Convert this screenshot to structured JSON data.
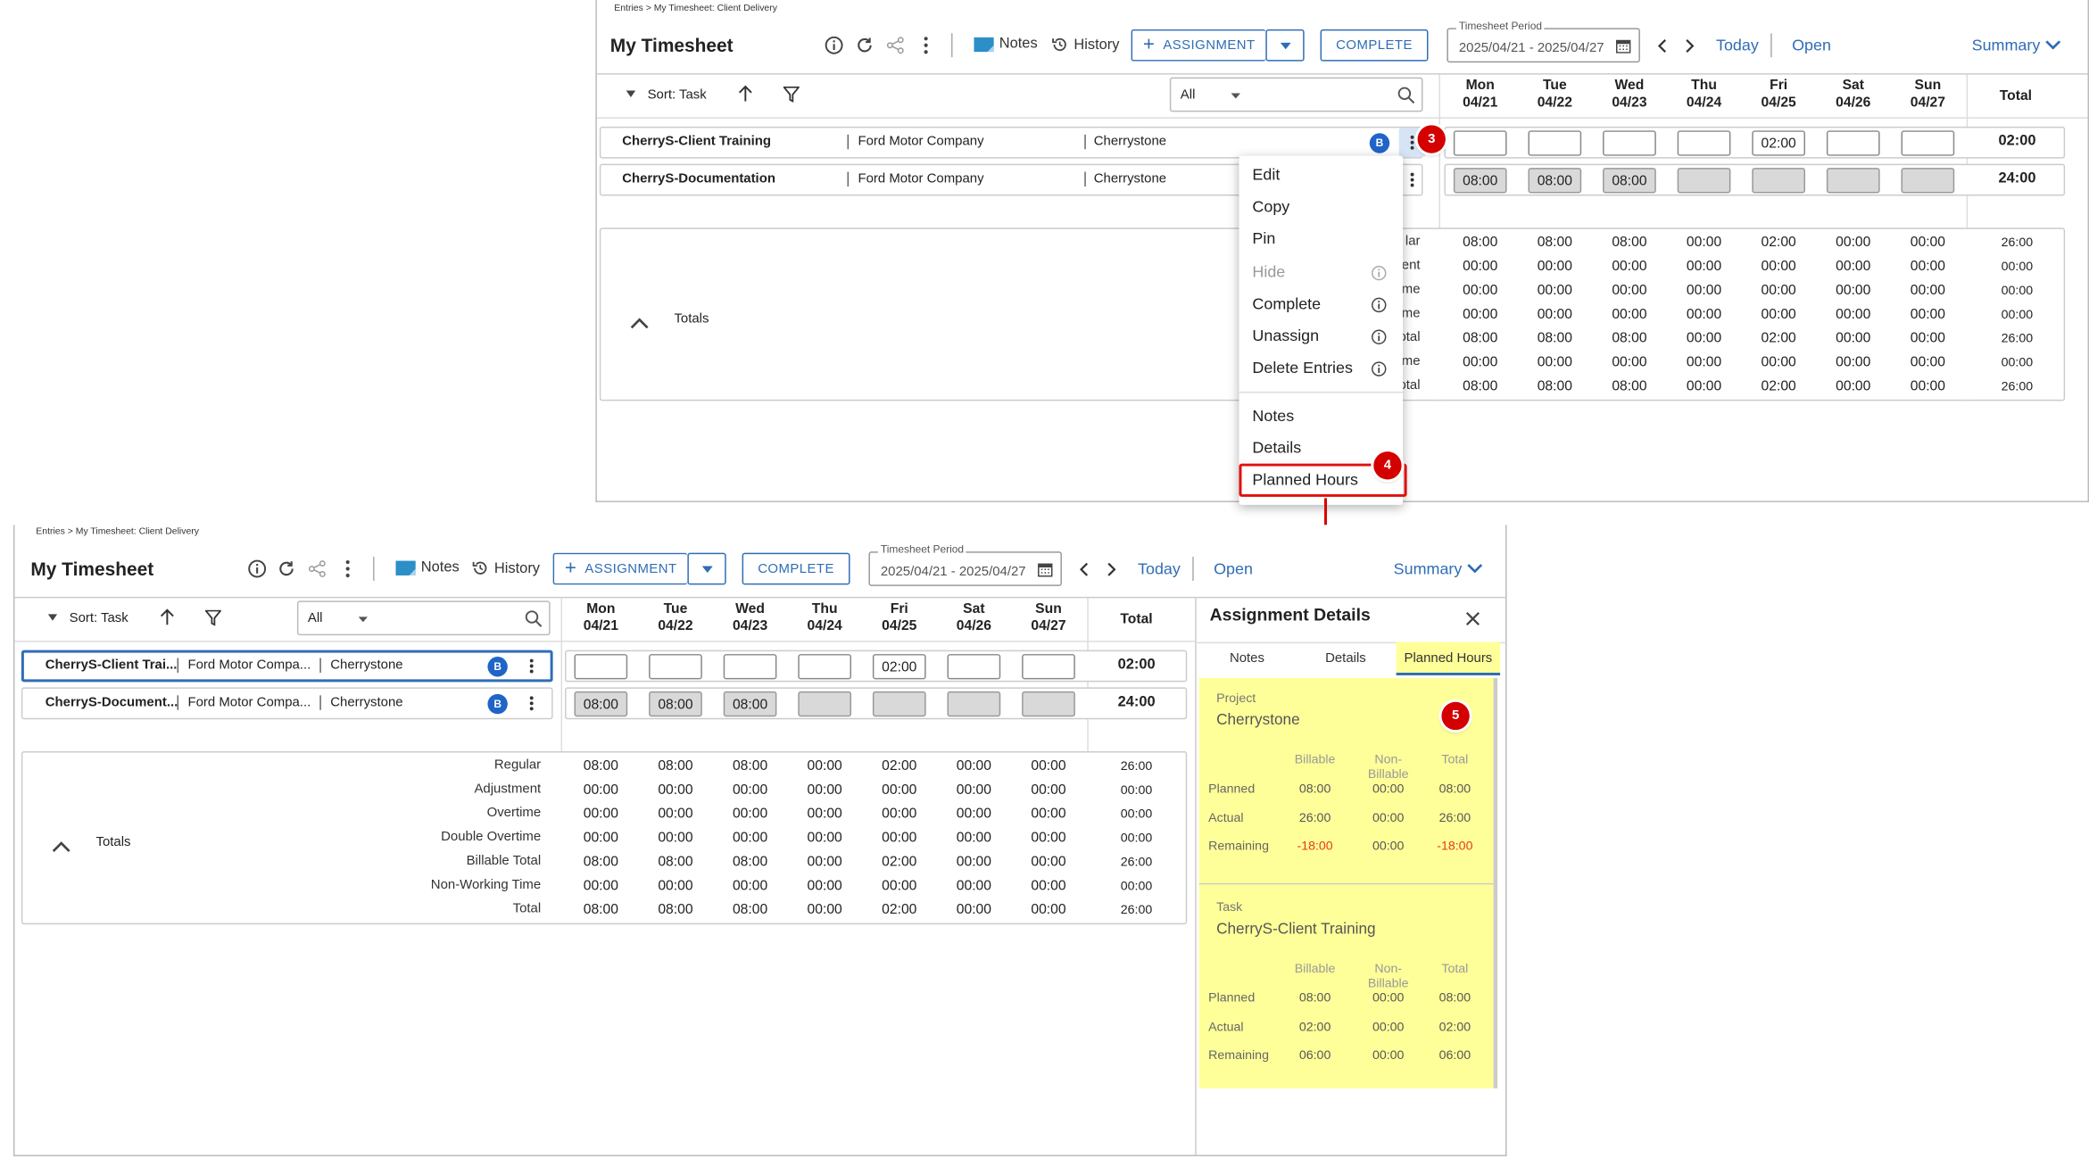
{
  "breadcrumb": "Entries > My Timesheet: Client Delivery",
  "page_title": "My Timesheet",
  "toolbar": {
    "notes": "Notes",
    "history": "History",
    "assignment": "ASSIGNMENT",
    "complete": "COMPLETE",
    "period_label": "Timesheet Period",
    "period_value": "2025/04/21 - 2025/04/27",
    "today": "Today",
    "open": "Open",
    "summary": "Summary"
  },
  "grid_toolbar": {
    "sort": "Sort: Task",
    "filter_value": "All"
  },
  "days": [
    {
      "name": "Mon",
      "date": "04/21"
    },
    {
      "name": "Tue",
      "date": "04/22"
    },
    {
      "name": "Wed",
      "date": "04/23"
    },
    {
      "name": "Thu",
      "date": "04/24"
    },
    {
      "name": "Fri",
      "date": "04/25"
    },
    {
      "name": "Sat",
      "date": "04/26"
    },
    {
      "name": "Sun",
      "date": "04/27"
    }
  ],
  "total_header": "Total",
  "rows": [
    {
      "task": "CherryS-Client Training",
      "task_short": "CherryS-Client Trai...",
      "client": "Ford Motor Company",
      "client_short": "Ford Motor Compa...",
      "project": "Cherrystone",
      "badge": "B",
      "hours": [
        "",
        "",
        "",
        "",
        "02:00",
        "",
        ""
      ],
      "total": "02:00"
    },
    {
      "task": "CherryS-Documentation",
      "task_short": "CherryS-Document...",
      "client": "Ford Motor Company",
      "client_short": "Ford Motor Compa...",
      "project": "Cherrystone",
      "badge": "B",
      "hours": [
        "08:00",
        "08:00",
        "08:00",
        "",
        "",
        "",
        ""
      ],
      "total": "24:00"
    }
  ],
  "totals": {
    "label": "Totals",
    "rows": [
      {
        "label": "Regular",
        "label_clip": "lar",
        "values": [
          "08:00",
          "08:00",
          "08:00",
          "00:00",
          "02:00",
          "00:00",
          "00:00"
        ],
        "total": "26:00"
      },
      {
        "label": "Adjustment",
        "label_clip": "ent",
        "values": [
          "00:00",
          "00:00",
          "00:00",
          "00:00",
          "00:00",
          "00:00",
          "00:00"
        ],
        "total": "00:00"
      },
      {
        "label": "Overtime",
        "label_clip": "me",
        "values": [
          "00:00",
          "00:00",
          "00:00",
          "00:00",
          "00:00",
          "00:00",
          "00:00"
        ],
        "total": "00:00"
      },
      {
        "label": "Double Overtime",
        "label_clip": "me",
        "values": [
          "00:00",
          "00:00",
          "00:00",
          "00:00",
          "00:00",
          "00:00",
          "00:00"
        ],
        "total": "00:00"
      },
      {
        "label": "Billable Total",
        "label_clip": "otal",
        "values": [
          "08:00",
          "08:00",
          "08:00",
          "00:00",
          "02:00",
          "00:00",
          "00:00"
        ],
        "total": "26:00"
      },
      {
        "label": "Non-Working Time",
        "label_clip": "me",
        "values": [
          "00:00",
          "00:00",
          "00:00",
          "00:00",
          "00:00",
          "00:00",
          "00:00"
        ],
        "total": "00:00"
      },
      {
        "label": "Total",
        "label_clip": "otal",
        "values": [
          "08:00",
          "08:00",
          "08:00",
          "00:00",
          "02:00",
          "00:00",
          "00:00"
        ],
        "total": "26:00"
      }
    ]
  },
  "context_menu": {
    "group1": [
      {
        "label": "Edit",
        "info": false,
        "disabled": false
      },
      {
        "label": "Copy",
        "info": false,
        "disabled": false
      },
      {
        "label": "Pin",
        "info": false,
        "disabled": false
      },
      {
        "label": "Hide",
        "info": true,
        "disabled": true
      },
      {
        "label": "Complete",
        "info": true,
        "disabled": false
      },
      {
        "label": "Unassign",
        "info": true,
        "disabled": false
      },
      {
        "label": "Delete Entries",
        "info": true,
        "disabled": false
      }
    ],
    "group2": [
      {
        "label": "Notes"
      },
      {
        "label": "Details"
      },
      {
        "label": "Planned Hours"
      }
    ]
  },
  "steps": [
    "3",
    "4",
    "5"
  ],
  "assignment_details": {
    "title": "Assignment Details",
    "tabs": [
      "Notes",
      "Details",
      "Planned Hours"
    ],
    "active_tab": "Planned Hours",
    "col_headers": [
      "Billable",
      "Non-Billable",
      "Total"
    ],
    "project": {
      "heading": "Project",
      "name": "Cherrystone",
      "rows": [
        {
          "label": "Planned",
          "values": [
            "08:00",
            "00:00",
            "08:00"
          ]
        },
        {
          "label": "Actual",
          "values": [
            "26:00",
            "00:00",
            "26:00"
          ]
        },
        {
          "label": "Remaining",
          "values": [
            "-18:00",
            "00:00",
            "-18:00"
          ]
        }
      ]
    },
    "task": {
      "heading": "Task",
      "name": "CherryS-Client Training",
      "rows": [
        {
          "label": "Planned",
          "values": [
            "08:00",
            "00:00",
            "08:00"
          ]
        },
        {
          "label": "Actual",
          "values": [
            "02:00",
            "00:00",
            "02:00"
          ]
        },
        {
          "label": "Remaining",
          "values": [
            "06:00",
            "00:00",
            "06:00"
          ]
        }
      ]
    }
  },
  "colors": {
    "accent": "#2f6db5",
    "highlight": "#ffff99",
    "step_red": "#d40000",
    "negative": "#e53b1c",
    "badge": "#1f64c8"
  }
}
